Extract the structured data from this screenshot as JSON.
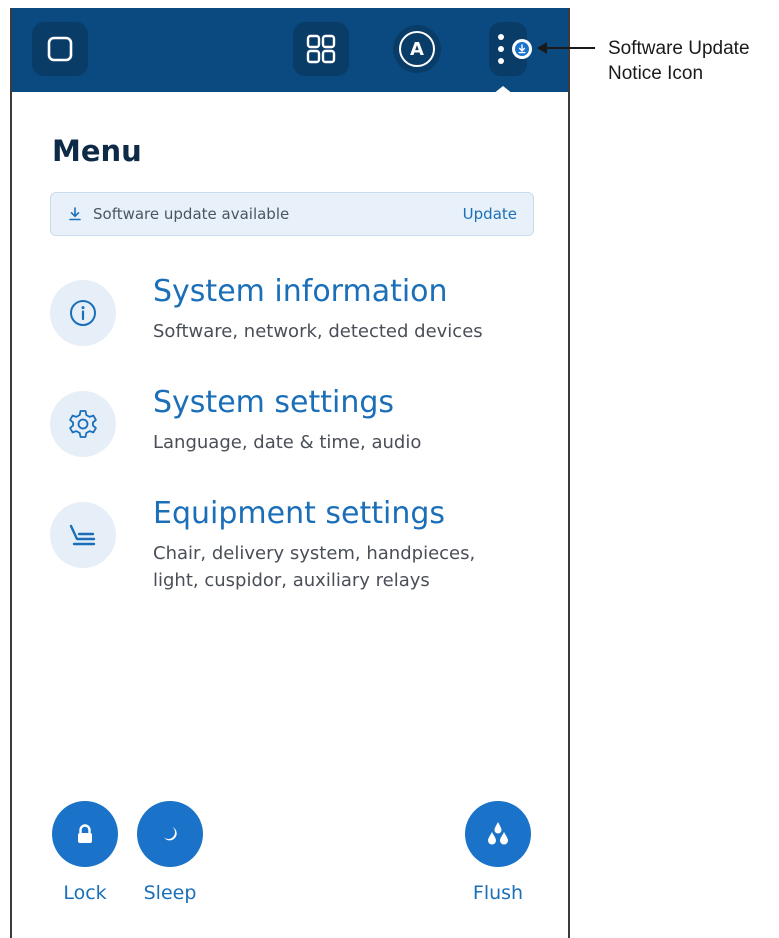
{
  "colors": {
    "topbar": "#0b4a80",
    "topbar_button": "#0a3c68",
    "accent": "#1b6fb8",
    "action_button": "#1a73c8",
    "title": "#0d2a47",
    "banner_bg": "#e8f1fa"
  },
  "topbar": {
    "icons": [
      "home-square-icon",
      "apps-grid-icon",
      "profile-a-icon",
      "more-vertical-icon",
      "download-badge-icon"
    ],
    "profile_letter": "A"
  },
  "menu": {
    "title": "Menu",
    "update_banner": {
      "icon": "download-icon",
      "text": "Software update available",
      "action_label": "Update"
    },
    "items": [
      {
        "icon": "info-icon",
        "title": "System information",
        "subtitle": "Software, network, detected devices"
      },
      {
        "icon": "gear-icon",
        "title": "System settings",
        "subtitle": "Language, date & time, audio"
      },
      {
        "icon": "dental-chair-icon",
        "title": "Equipment settings",
        "subtitle": "Chair, delivery system, handpieces, light, cuspidor, auxiliary relays"
      }
    ]
  },
  "actions": [
    {
      "icon": "lock-icon",
      "label": "Lock"
    },
    {
      "icon": "moon-icon",
      "label": "Sleep"
    },
    {
      "icon": "water-drops-icon",
      "label": "Flush"
    }
  ],
  "callout": {
    "text": "Software Update Notice Icon"
  }
}
